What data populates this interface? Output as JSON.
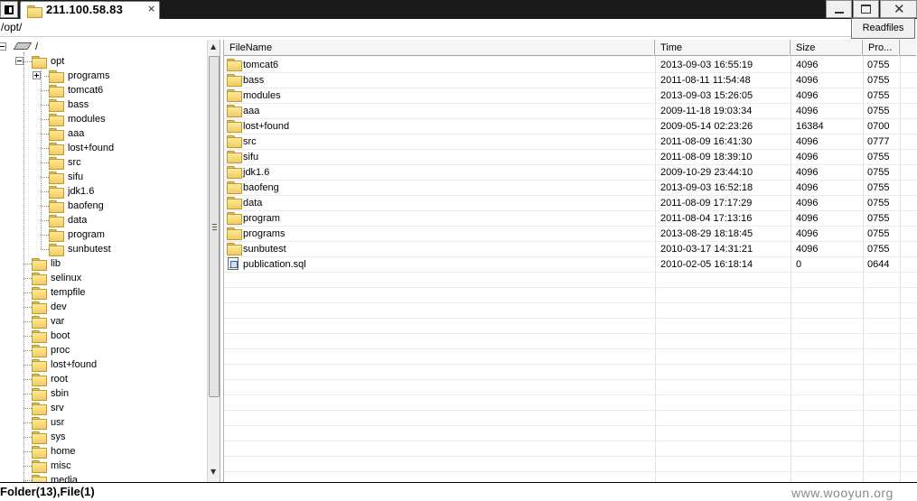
{
  "window": {
    "tab_title": "211.100.58.83",
    "tab_close": "×",
    "close_glyph": "✕"
  },
  "pathbar": {
    "path": "/opt/",
    "readfiles_label": "Readfiles"
  },
  "tree": {
    "root_label": "/",
    "opt_label": "opt",
    "opt_children": [
      "programs",
      "tomcat6",
      "bass",
      "modules",
      "aaa",
      "lost+found",
      "src",
      "sifu",
      "jdk1.6",
      "baofeng",
      "data",
      "program",
      "sunbutest"
    ],
    "root_children": [
      "lib",
      "selinux",
      "tempfile",
      "dev",
      "var",
      "boot",
      "proc",
      "lost+found",
      "root",
      "sbin",
      "srv",
      "usr",
      "sys",
      "home",
      "misc",
      "media"
    ]
  },
  "list": {
    "columns": [
      "FileName",
      "Time",
      "Size",
      "Pro..."
    ],
    "rows": [
      {
        "name": "tomcat6",
        "time": "2013-09-03 16:55:19",
        "size": "4096",
        "perm": "0755",
        "type": "folder"
      },
      {
        "name": "bass",
        "time": "2011-08-11 11:54:48",
        "size": "4096",
        "perm": "0755",
        "type": "folder"
      },
      {
        "name": "modules",
        "time": "2013-09-03 15:26:05",
        "size": "4096",
        "perm": "0755",
        "type": "folder"
      },
      {
        "name": "aaa",
        "time": "2009-11-18 19:03:34",
        "size": "4096",
        "perm": "0755",
        "type": "folder"
      },
      {
        "name": "lost+found",
        "time": "2009-05-14 02:23:26",
        "size": "16384",
        "perm": "0700",
        "type": "folder"
      },
      {
        "name": "src",
        "time": "2011-08-09 16:41:30",
        "size": "4096",
        "perm": "0777",
        "type": "folder"
      },
      {
        "name": "sifu",
        "time": "2011-08-09 18:39:10",
        "size": "4096",
        "perm": "0755",
        "type": "folder"
      },
      {
        "name": "jdk1.6",
        "time": "2009-10-29 23:44:10",
        "size": "4096",
        "perm": "0755",
        "type": "folder"
      },
      {
        "name": "baofeng",
        "time": "2013-09-03 16:52:18",
        "size": "4096",
        "perm": "0755",
        "type": "folder"
      },
      {
        "name": "data",
        "time": "2011-08-09 17:17:29",
        "size": "4096",
        "perm": "0755",
        "type": "folder"
      },
      {
        "name": "program",
        "time": "2011-08-04 17:13:16",
        "size": "4096",
        "perm": "0755",
        "type": "folder"
      },
      {
        "name": "programs",
        "time": "2013-08-29 18:18:45",
        "size": "4096",
        "perm": "0755",
        "type": "folder"
      },
      {
        "name": "sunbutest",
        "time": "2010-03-17 14:31:21",
        "size": "4096",
        "perm": "0755",
        "type": "folder"
      },
      {
        "name": "publication.sql",
        "time": "2010-02-05 16:18:14",
        "size": "0",
        "perm": "0644",
        "type": "file"
      }
    ]
  },
  "status": {
    "summary": "Folder(13),File(1)",
    "watermark": "www.wooyun.org"
  }
}
